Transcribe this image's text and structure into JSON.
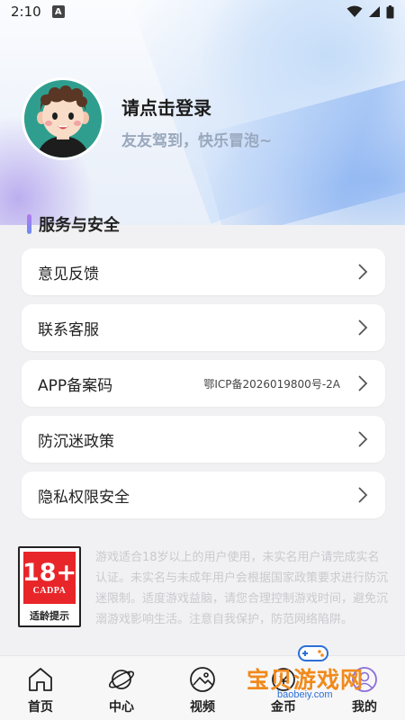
{
  "status_bar": {
    "time": "2:10",
    "notification_badge": "A"
  },
  "profile": {
    "login_title": "请点击登录",
    "login_subtitle": "友友驾到，快乐冒泡~"
  },
  "section": {
    "title": "服务与安全"
  },
  "menu": [
    {
      "label": "意见反馈",
      "value": ""
    },
    {
      "label": "联系客服",
      "value": ""
    },
    {
      "label": "APP备案码",
      "value": "鄂ICP备2026019800号-2A"
    },
    {
      "label": "防沉迷政策",
      "value": ""
    },
    {
      "label": "隐私权限安全",
      "value": ""
    }
  ],
  "age_badge": {
    "age": "18+",
    "org": "CADPA",
    "tip": "适龄提示"
  },
  "notice": "游戏适合18岁以上的用户使用，未实名用户请完成实名认证。未实名与未成年用户会根据国家政策要求进行防沉迷限制。适度游戏益脑，请您合理控制游戏时间，避免沉溺游戏影响生活。注意自我保护，防范网络陷阱。",
  "bottom_nav": [
    {
      "label": "首页",
      "icon": "home-icon"
    },
    {
      "label": "中心",
      "icon": "planet-icon"
    },
    {
      "label": "视频",
      "icon": "image-icon"
    },
    {
      "label": "金币",
      "icon": "coin-icon"
    },
    {
      "label": "我的",
      "icon": "user-icon"
    }
  ],
  "watermark": {
    "text": "宝贝游戏网",
    "url": "baobeiy.com"
  },
  "colors": {
    "accent_bar_top": "#b57af0",
    "accent_bar_bottom": "#6a8cf2",
    "badge_red": "#e8262a",
    "watermark_orange": "#f08a1c"
  }
}
